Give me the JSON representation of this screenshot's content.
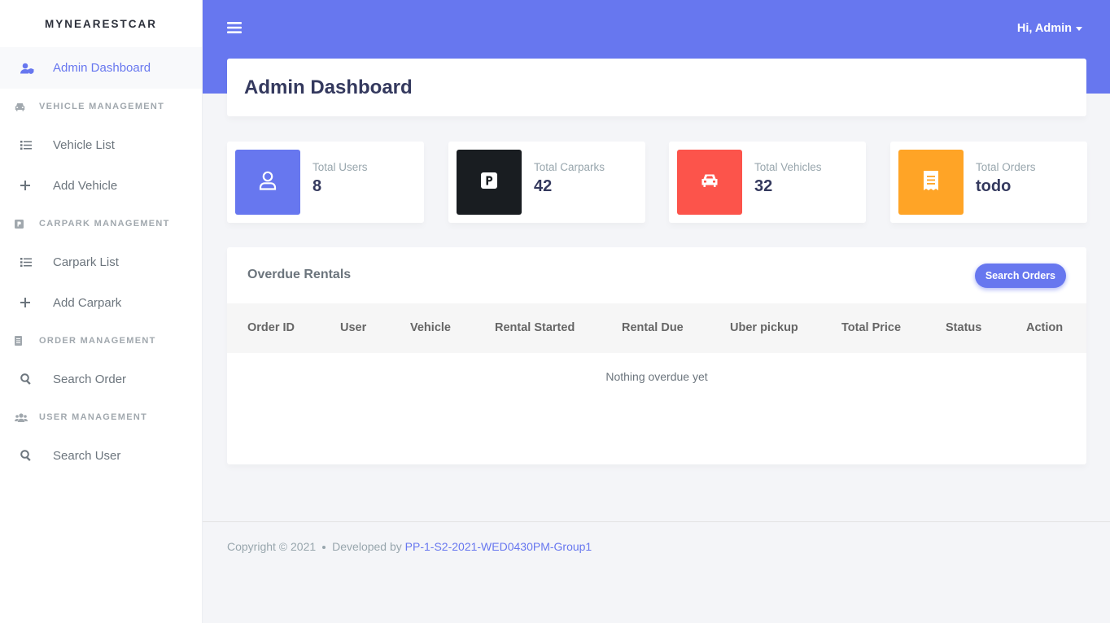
{
  "brand": "MYNEARESTCAR",
  "sidebar": {
    "active_item": "Admin Dashboard",
    "sections": [
      {
        "header": "VEHICLE MANAGEMENT",
        "header_icon": "car-icon",
        "items": [
          {
            "label": "Vehicle List",
            "icon": "list-icon"
          },
          {
            "label": "Add Vehicle",
            "icon": "plus-icon"
          }
        ]
      },
      {
        "header": "CARPARK MANAGEMENT",
        "header_icon": "parking-icon",
        "items": [
          {
            "label": "Carpark List",
            "icon": "list-icon"
          },
          {
            "label": "Add Carpark",
            "icon": "plus-icon"
          }
        ]
      },
      {
        "header": "ORDER MANAGEMENT",
        "header_icon": "document-icon",
        "items": [
          {
            "label": "Search Order",
            "icon": "search-icon"
          }
        ]
      },
      {
        "header": "USER MANAGEMENT",
        "header_icon": "users-icon",
        "items": [
          {
            "label": "Search User",
            "icon": "search-icon"
          }
        ]
      }
    ]
  },
  "topbar": {
    "user_greeting": "Hi, Admin"
  },
  "page": {
    "title": "Admin Dashboard"
  },
  "stats": [
    {
      "label": "Total Users",
      "value": "8",
      "color": "#6777ef",
      "icon": "user-icon"
    },
    {
      "label": "Total Carparks",
      "value": "42",
      "color": "#191d21",
      "icon": "parking-icon"
    },
    {
      "label": "Total Vehicles",
      "value": "32",
      "color": "#fc544b",
      "icon": "car-icon"
    },
    {
      "label": "Total Orders",
      "value": "todo",
      "color": "#ffa426",
      "icon": "receipt-icon"
    }
  ],
  "overdue": {
    "title": "Overdue Rentals",
    "button": "Search Orders",
    "columns": [
      "Order ID",
      "User",
      "Vehicle",
      "Rental Started",
      "Rental Due",
      "Uber pickup",
      "Total Price",
      "Status",
      "Action"
    ],
    "empty_message": "Nothing overdue yet"
  },
  "footer": {
    "copyright": "Copyright © 2021",
    "developed_by": "Developed by",
    "developer": "PP-1-S2-2021-WED0430PM-Group1"
  },
  "colors": {
    "primary": "#6777ef",
    "dark": "#191d21",
    "danger": "#fc544b",
    "warning": "#ffa426"
  }
}
